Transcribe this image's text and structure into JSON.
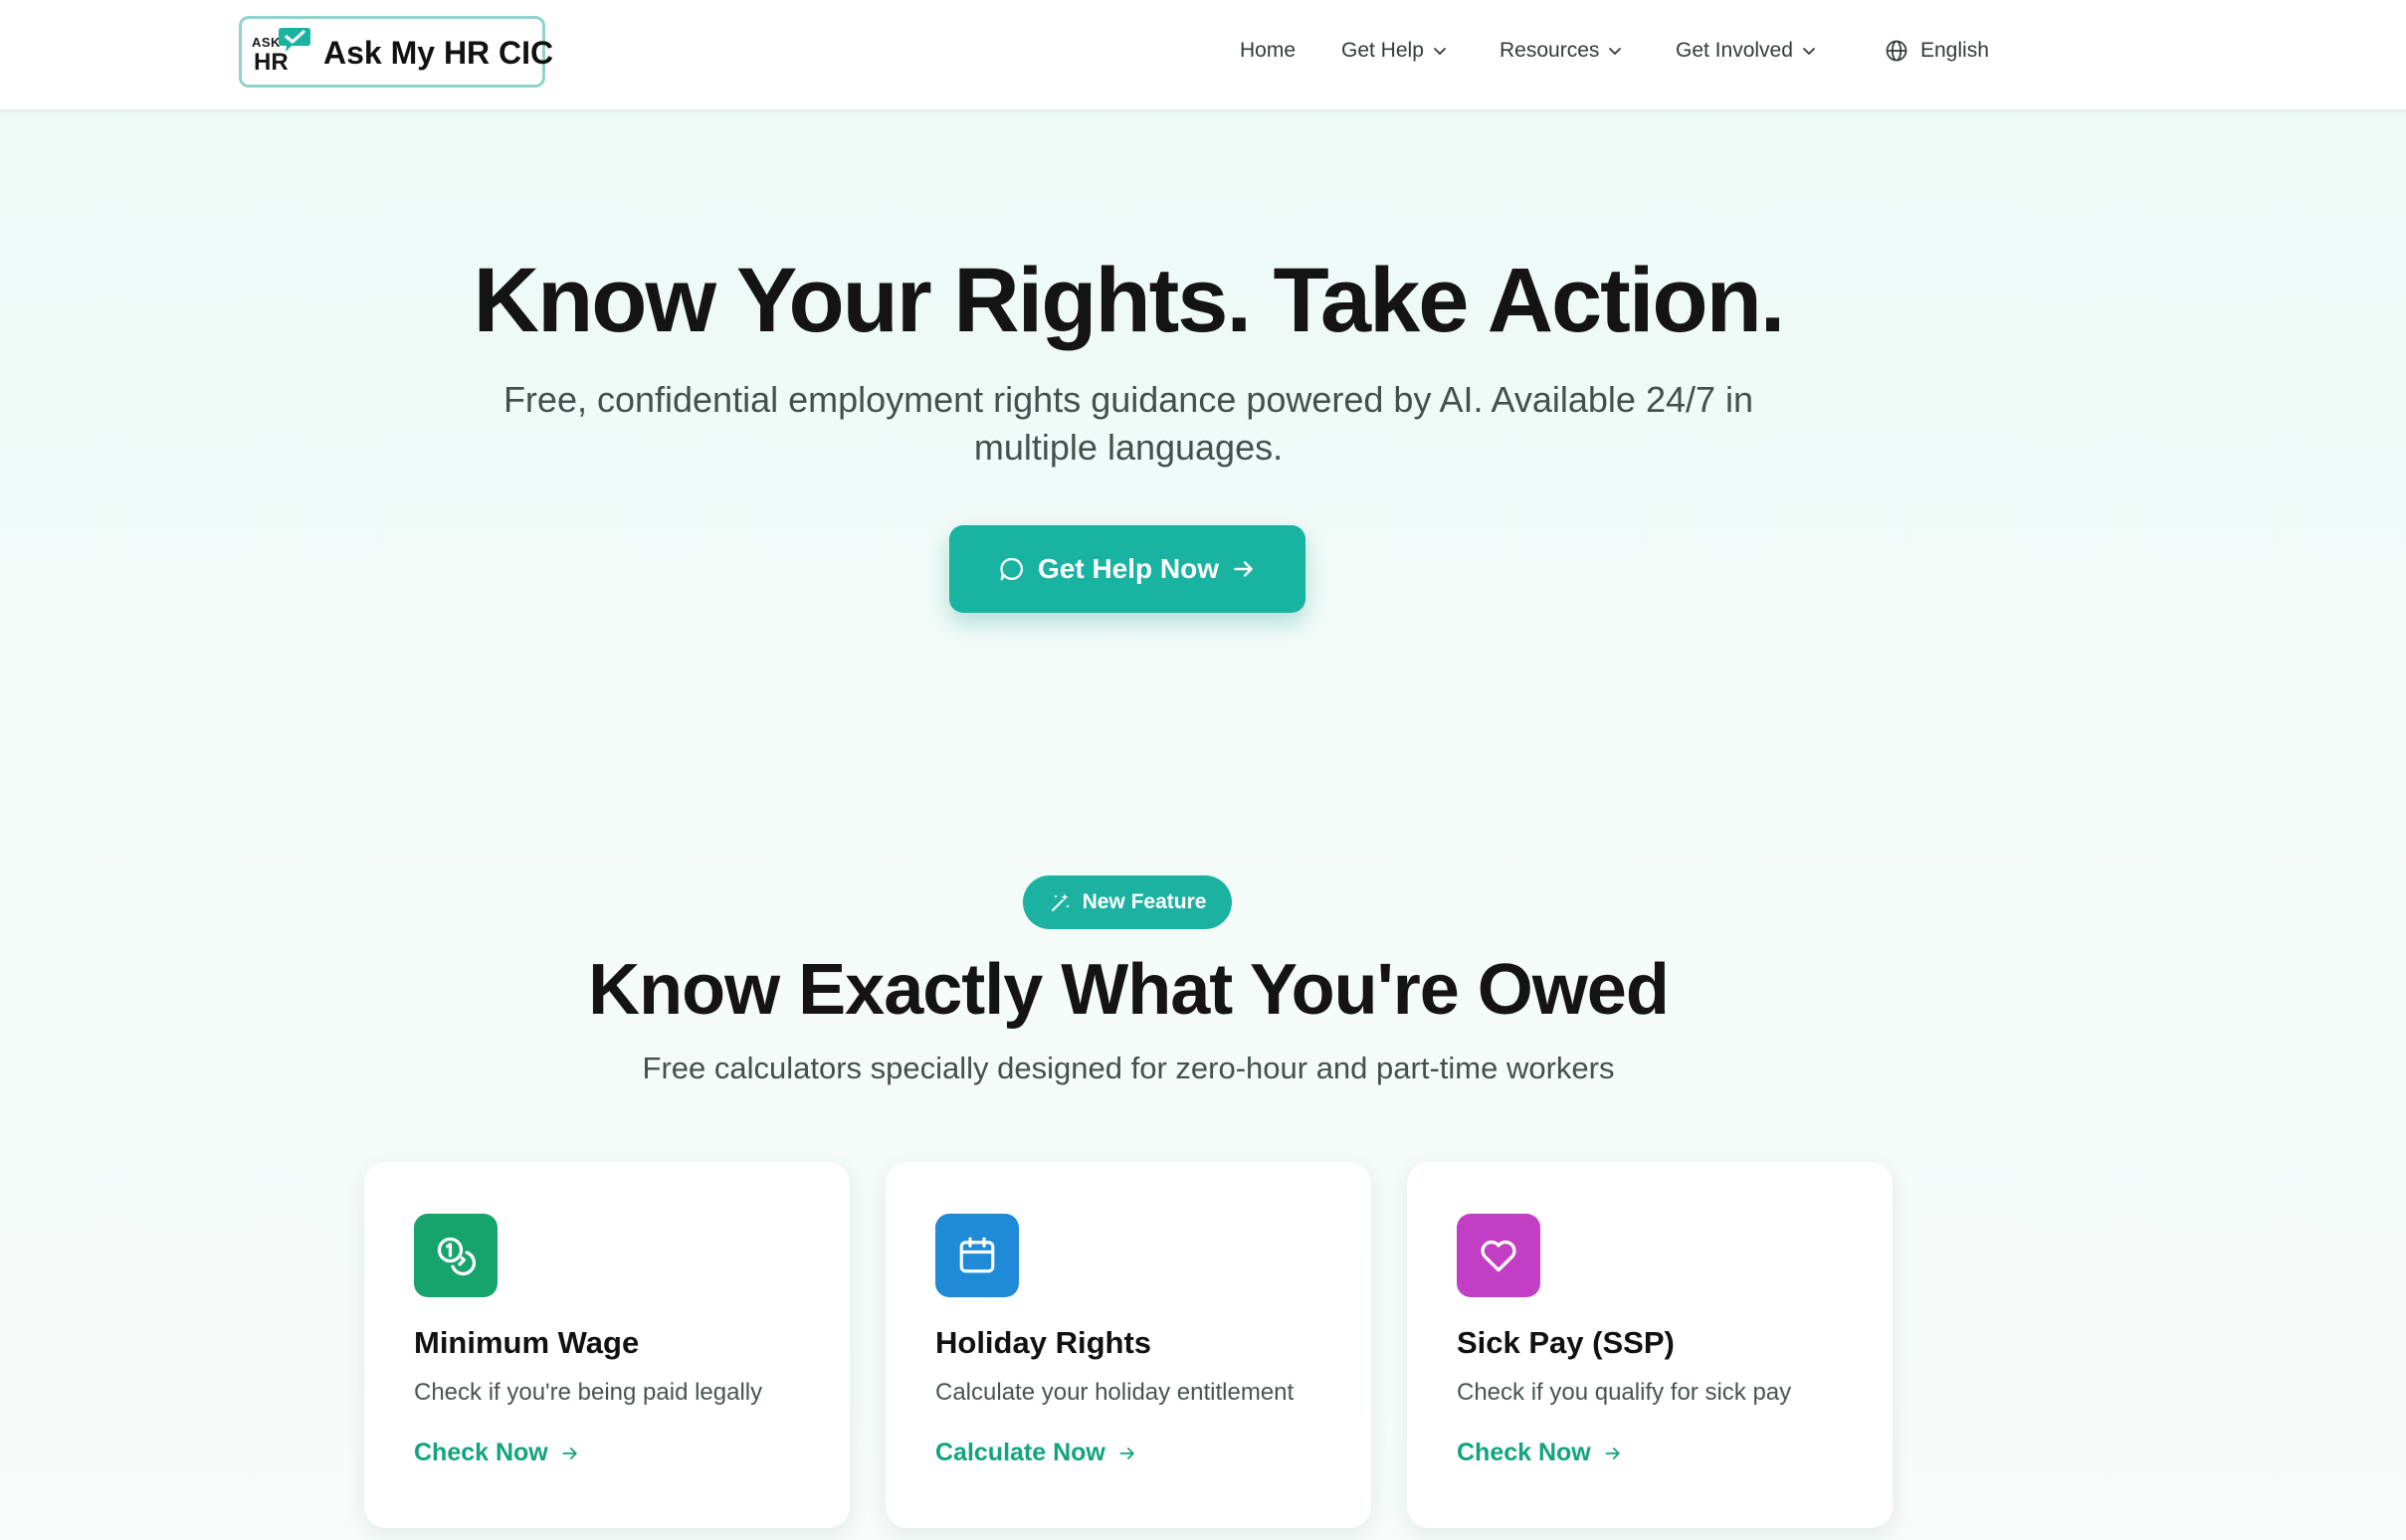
{
  "header": {
    "logo": {
      "ask": "ASK",
      "my": "MY",
      "hr": "HR",
      "name": "Ask My HR CIC"
    },
    "nav": [
      {
        "label": "Home",
        "has_dropdown": false
      },
      {
        "label": "Get Help",
        "has_dropdown": true
      },
      {
        "label": "Resources",
        "has_dropdown": true
      },
      {
        "label": "Get Involved",
        "has_dropdown": true
      }
    ],
    "language": {
      "label": "English",
      "icon": "globe-icon"
    }
  },
  "hero": {
    "title": "Know Your Rights. Take Action.",
    "subtitle": "Free, confidential employment rights guidance powered by AI. Available 24/7 in multiple languages.",
    "cta_label": "Get Help Now"
  },
  "feature": {
    "badge": "New Feature",
    "title": "Know Exactly What You're Owed",
    "subtitle": "Free calculators specially designed for zero-hour and part-time workers",
    "cards": [
      {
        "title": "Minimum Wage",
        "description": "Check if you're being paid legally",
        "link": "Check Now",
        "icon": "coins-icon",
        "color": "#16a36c"
      },
      {
        "title": "Holiday Rights",
        "description": "Calculate your holiday entitlement",
        "link": "Calculate Now",
        "icon": "calendar-icon",
        "color": "#1f8ad8"
      },
      {
        "title": "Sick Pay (SSP)",
        "description": "Check if you qualify for sick pay",
        "link": "Check Now",
        "icon": "heart-icon",
        "color": "#c23ec4"
      }
    ]
  },
  "colors": {
    "accent": "#18b3a1",
    "link": "#13a37f",
    "background": "#ecfaf6"
  }
}
